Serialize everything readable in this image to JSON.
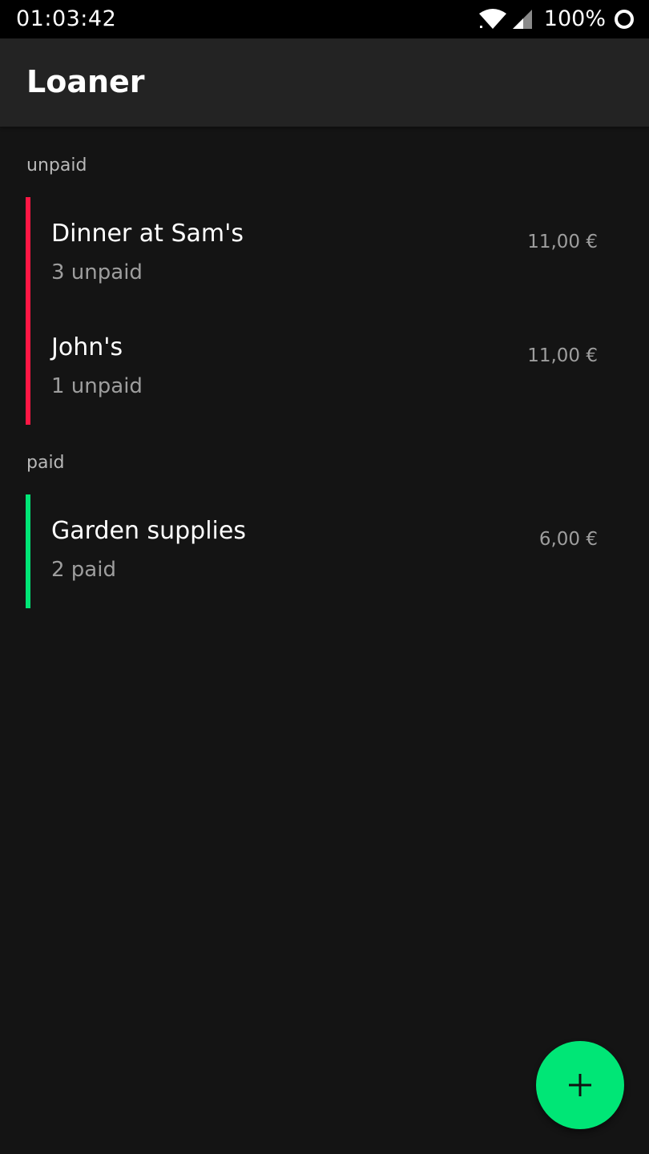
{
  "status_bar": {
    "time": "01:03:42",
    "battery_text": "100%",
    "icons": [
      "wifi-icon",
      "cell-signal-icon",
      "battery-saver-icon"
    ]
  },
  "app_bar": {
    "title": "Loaner"
  },
  "sections": [
    {
      "header": "unpaid",
      "accent_color": "#ff1744",
      "items": [
        {
          "title": "Dinner at Sam's",
          "subtitle": "3 unpaid",
          "amount": "11,00 €"
        },
        {
          "title": "John's",
          "subtitle": "1 unpaid",
          "amount": "11,00 €"
        }
      ]
    },
    {
      "header": "paid",
      "accent_color": "#00e676",
      "items": [
        {
          "title": "Garden supplies",
          "subtitle": "2 paid",
          "amount": "6,00 €"
        }
      ]
    }
  ],
  "fab": {
    "icon": "plus-icon",
    "color": "#00e676"
  }
}
